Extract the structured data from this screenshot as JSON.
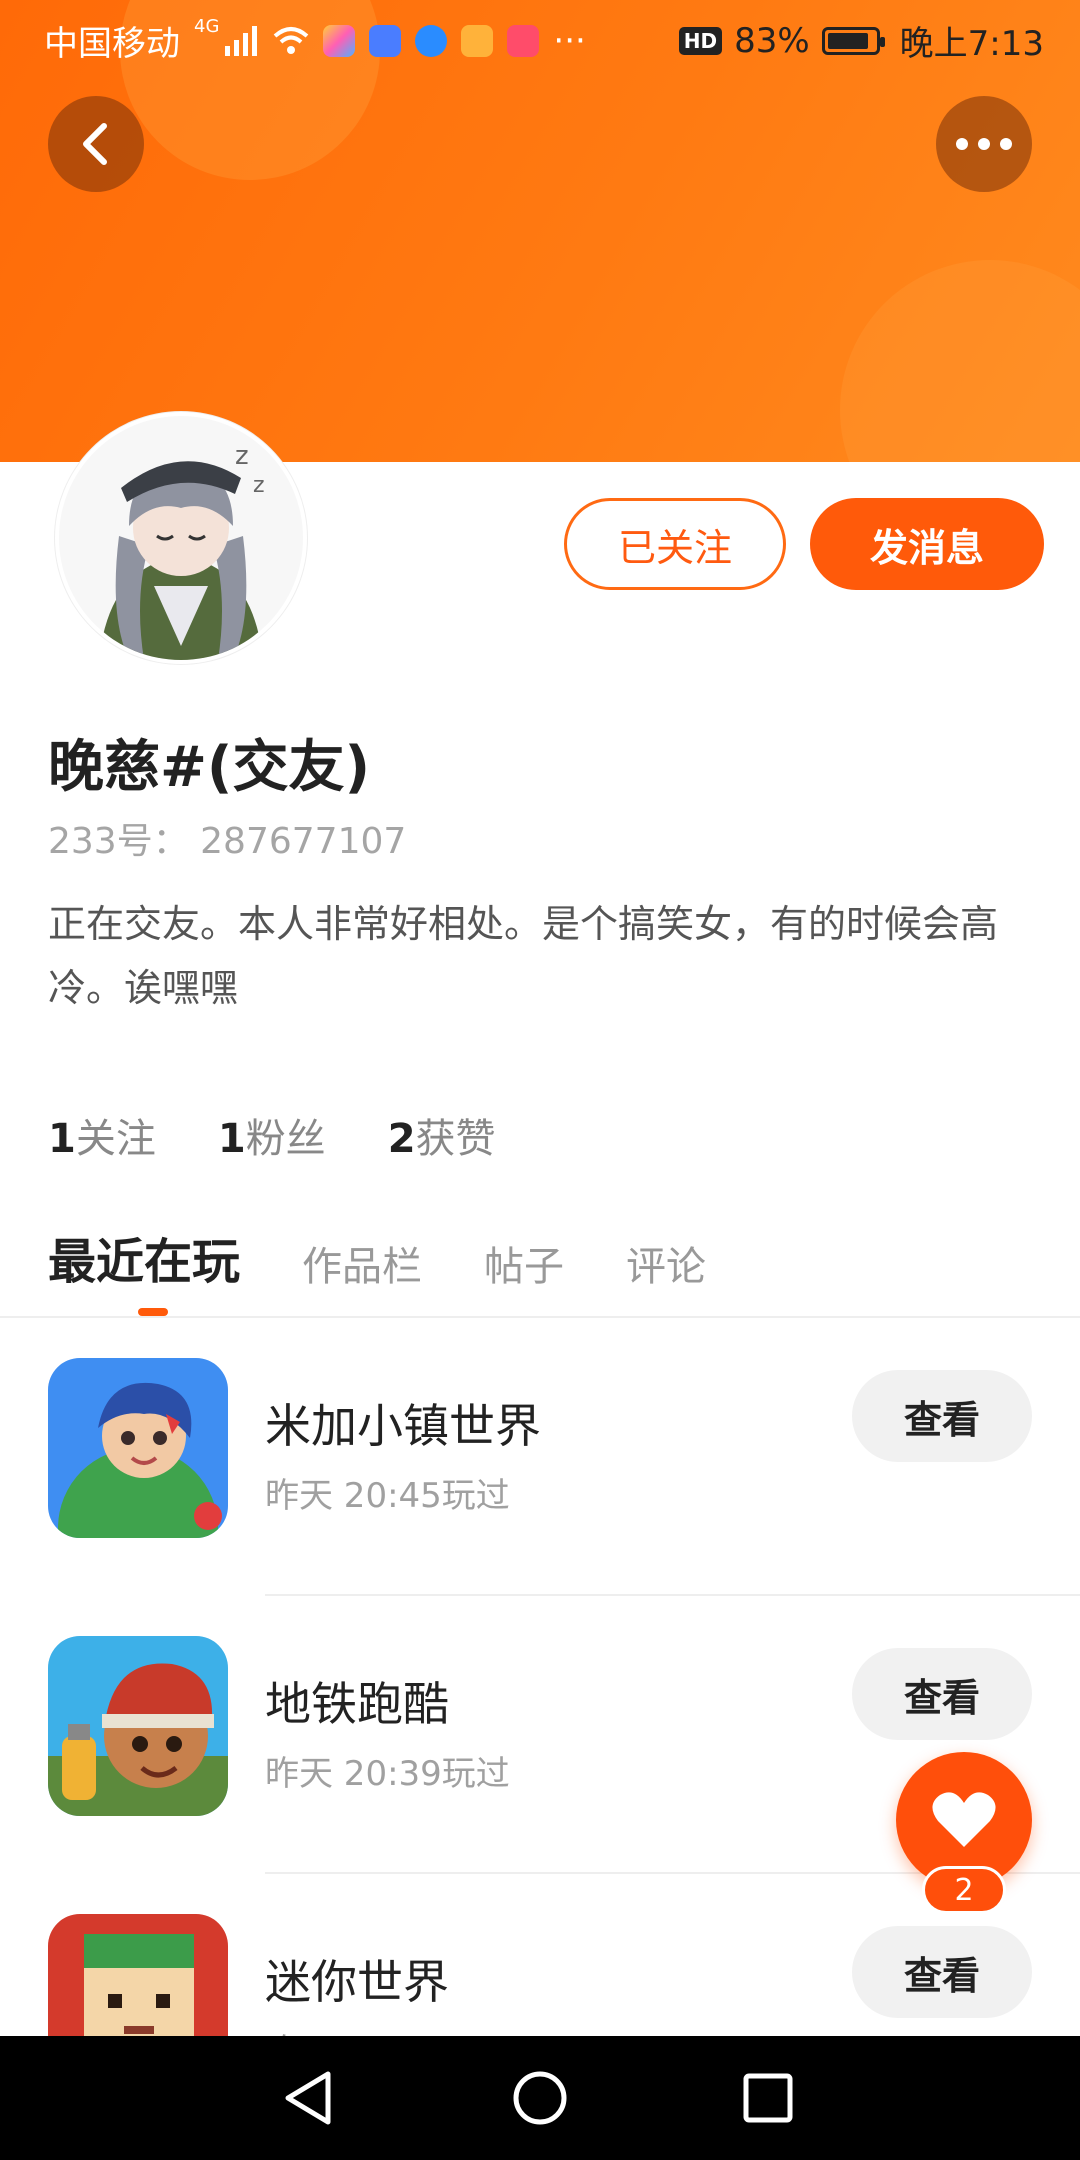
{
  "status_bar": {
    "carrier": "中国移动",
    "network": "4G",
    "overflow": "···",
    "hd": "HD",
    "battery": "83%",
    "time": "晚上7:13"
  },
  "profile": {
    "follow_label": "已关注",
    "message_label": "发消息",
    "username": "晚慈#(交友)",
    "uid": "233号：  287677107",
    "bio": "正在交友。本人非常好相处。是个搞笑女，有的时候会高冷。诶嘿嘿"
  },
  "stats": [
    {
      "num": "1",
      "label": "关注"
    },
    {
      "num": "1",
      "label": "粉丝"
    },
    {
      "num": "2",
      "label": "获赞"
    }
  ],
  "tabs": [
    "最近在玩",
    "作品栏",
    "帖子",
    "评论"
  ],
  "games": [
    {
      "name": "米加小镇世界",
      "time": "昨天 20:45玩过",
      "button": "查看"
    },
    {
      "name": "地铁跑酷",
      "time": "昨天 20:39玩过",
      "button": "查看"
    },
    {
      "name": "迷你世界",
      "time": "昨天",
      "button": "查看"
    }
  ],
  "like_count": "2",
  "colors": {
    "accent": "#ff5a0a",
    "header": "#ff7a12"
  }
}
